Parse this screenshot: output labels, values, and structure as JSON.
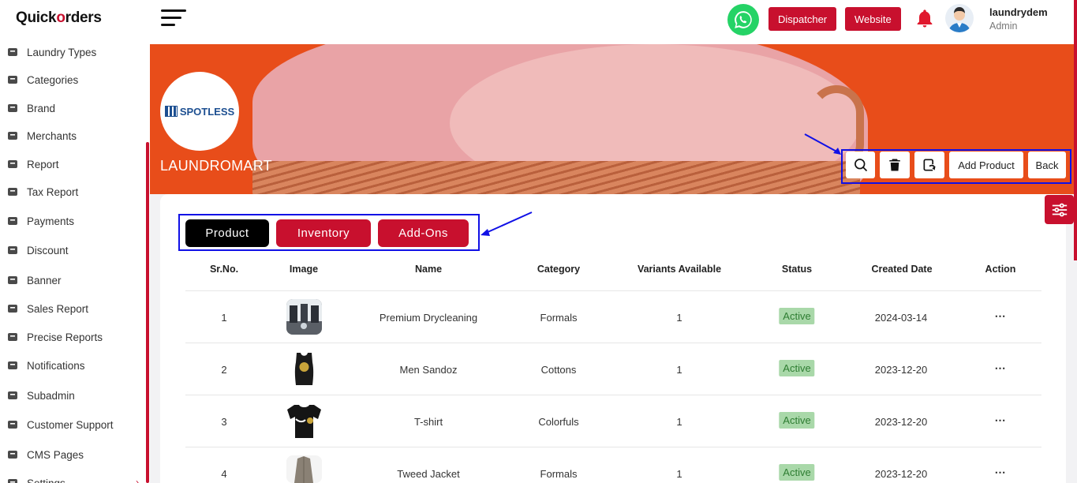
{
  "app": {
    "logo_text_1": "Quick",
    "logo_text_2": "orders"
  },
  "sidebar": {
    "items": [
      {
        "label": "Laundry Types",
        "icon": "basket-icon"
      },
      {
        "label": "Categories",
        "icon": "tag-icon"
      },
      {
        "label": "Brand",
        "icon": "brand-icon"
      },
      {
        "label": "Merchants",
        "icon": "merchant-icon"
      },
      {
        "label": "Report",
        "icon": "report-icon"
      },
      {
        "label": "Tax Report",
        "icon": "tax-icon"
      },
      {
        "label": "Payments",
        "icon": "payment-icon"
      },
      {
        "label": "Discount",
        "icon": "discount-icon"
      },
      {
        "label": "Banner",
        "icon": "image-icon"
      },
      {
        "label": "Sales Report",
        "icon": "chart-icon"
      },
      {
        "label": "Precise Reports",
        "icon": "chart-icon"
      },
      {
        "label": "Notifications",
        "icon": "bell-icon"
      },
      {
        "label": "Subadmin",
        "icon": "users-icon"
      },
      {
        "label": "Customer Support",
        "icon": "chat-icon"
      },
      {
        "label": "CMS Pages",
        "icon": "pages-icon"
      },
      {
        "label": "Settings",
        "icon": "gear-icon"
      }
    ]
  },
  "header": {
    "dispatcher_label": "Dispatcher",
    "website_label": "Website",
    "user_name": "laundrydem",
    "user_role": "Admin"
  },
  "store": {
    "logo_text": "SPOTLESS",
    "name": "LAUNDROMART"
  },
  "actions": {
    "add_product_label": "Add Product",
    "back_label": "Back"
  },
  "tabs": [
    {
      "label": "Product",
      "active": true
    },
    {
      "label": "Inventory",
      "active": false
    },
    {
      "label": "Add-Ons",
      "active": false
    }
  ],
  "table": {
    "headers": [
      "Sr.No.",
      "Image",
      "Name",
      "Category",
      "Variants Available",
      "Status",
      "Created Date",
      "Action"
    ],
    "rows": [
      {
        "sr": "1",
        "name": "Premium Drycleaning",
        "category": "Formals",
        "variants": "1",
        "status": "Active",
        "date": "2024-03-14",
        "action": "⋯"
      },
      {
        "sr": "2",
        "name": "Men Sandoz",
        "category": "Cottons",
        "variants": "1",
        "status": "Active",
        "date": "2023-12-20",
        "action": "⋯"
      },
      {
        "sr": "3",
        "name": "T-shirt",
        "category": "Colorfuls",
        "variants": "1",
        "status": "Active",
        "date": "2023-12-20",
        "action": "⋯"
      },
      {
        "sr": "4",
        "name": "Tweed Jacket",
        "category": "Formals",
        "variants": "1",
        "status": "Active",
        "date": "2023-12-20",
        "action": "⋯"
      }
    ]
  },
  "colors": {
    "brand_red": "#c8102e",
    "banner_orange": "#e84d1a",
    "annotation_blue": "#1010e6",
    "status_green": "#a9d8a9"
  }
}
